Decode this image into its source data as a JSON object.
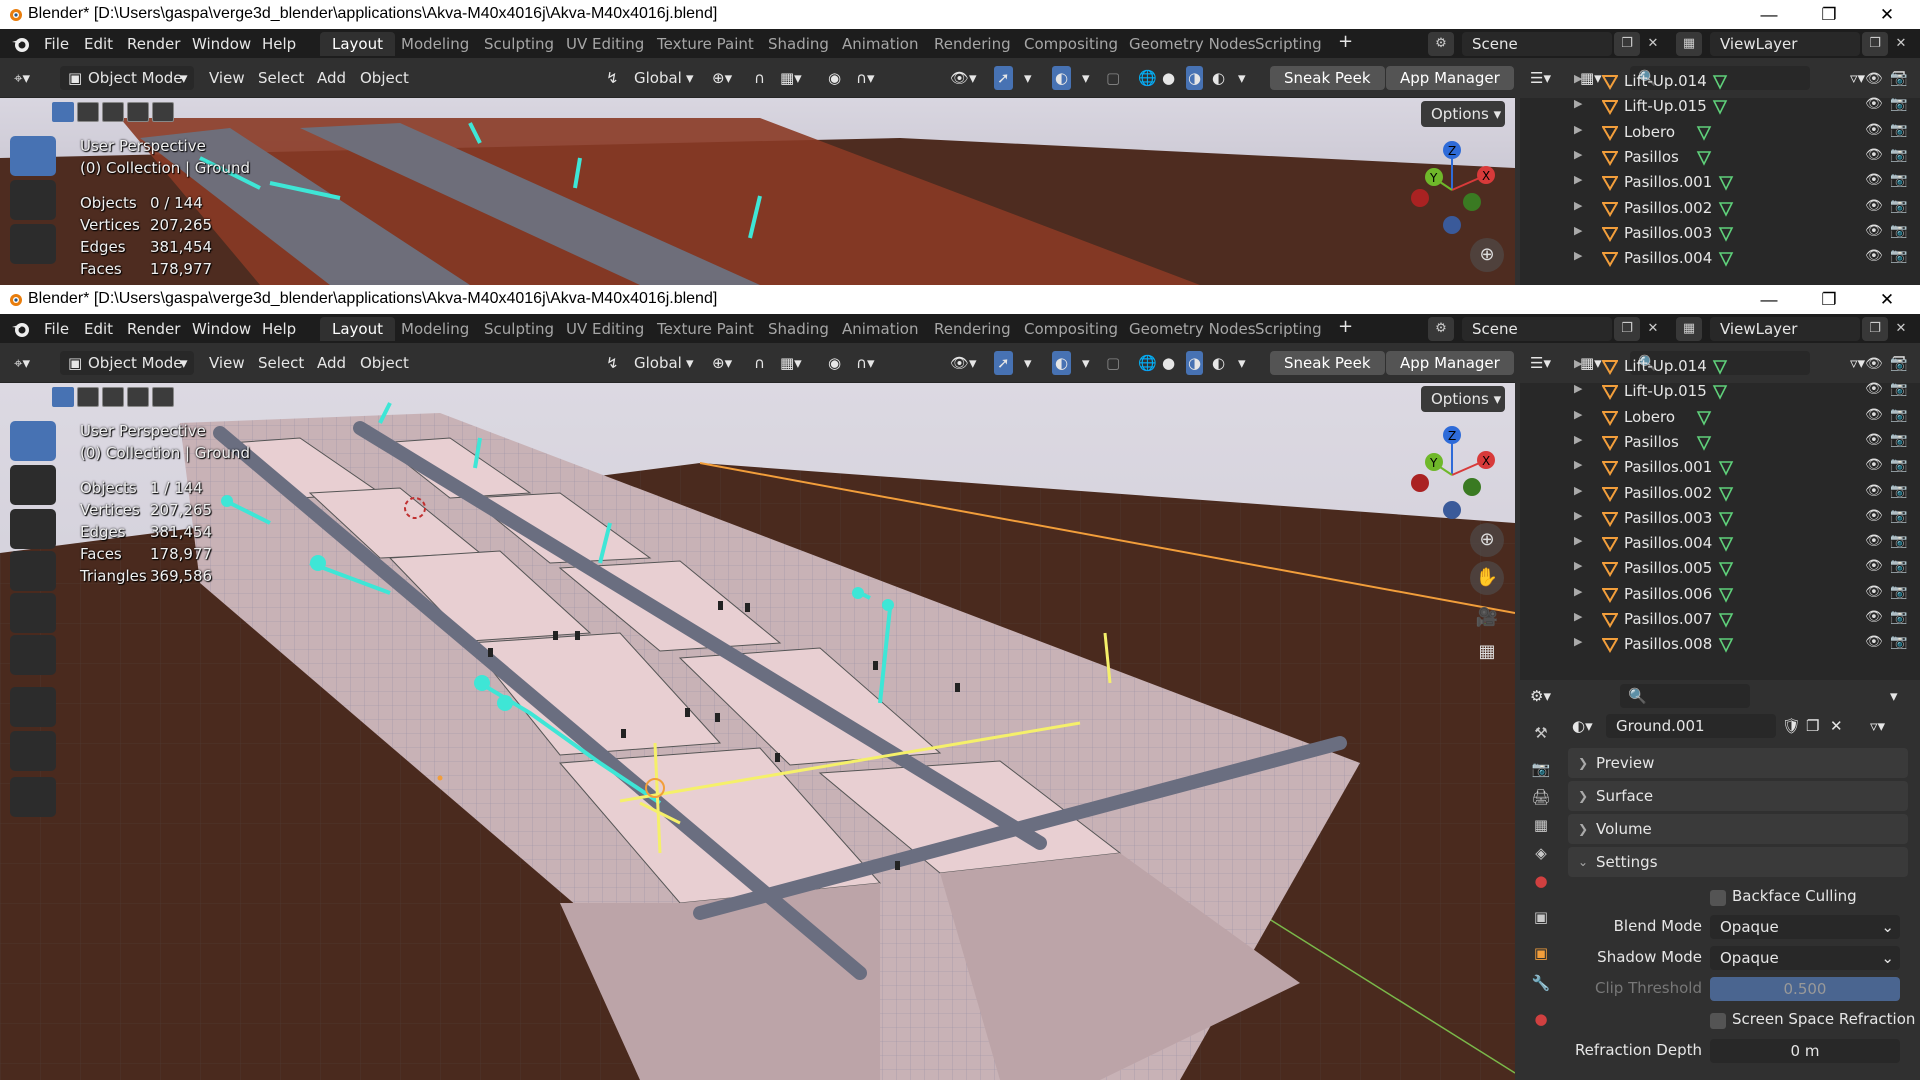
{
  "titlebar": {
    "title": "Blender* [D:\\Users\\gaspa\\verge3d_blender\\applications\\Akva-M40x4016j\\Akva-M40x4016j.blend]"
  },
  "menu": [
    "File",
    "Edit",
    "Render",
    "Window",
    "Help"
  ],
  "workspaces": [
    "Layout",
    "Modeling",
    "Sculpting",
    "UV Editing",
    "Texture Paint",
    "Shading",
    "Animation",
    "Rendering",
    "Compositing",
    "Geometry Nodes",
    "Scripting"
  ],
  "scene": {
    "name": "Scene",
    "view_layer": "ViewLayer"
  },
  "viewport_header": {
    "mode": "Object Mode",
    "menus": [
      "View",
      "Select",
      "Add",
      "Object"
    ],
    "transform_orientation": "Global",
    "sneak_peek": "Sneak Peek",
    "app_manager": "App Manager",
    "options": "Options"
  },
  "overlay": {
    "perspective": "User Perspective",
    "collection": "(0) Collection | Ground"
  },
  "stats_top": {
    "objects_label": "Objects",
    "objects": "0 / 144",
    "vertices_label": "Vertices",
    "vertices": "207,265",
    "edges_label": "Edges",
    "edges": "381,454",
    "faces_label": "Faces",
    "faces": "178,977"
  },
  "stats_bottom": {
    "objects_label": "Objects",
    "objects": "1 / 144",
    "vertices_label": "Vertices",
    "vertices": "207,265",
    "edges_label": "Edges",
    "edges": "381,454",
    "faces_label": "Faces",
    "faces": "178,977",
    "triangles_label": "Triangles",
    "triangles": "369,586"
  },
  "gizmo": {
    "x": "X",
    "y": "Y",
    "z": "Z"
  },
  "outliner_top": [
    "Lift-Up.014",
    "Lift-Up.015",
    "Lobero",
    "Pasillos",
    "Pasillos.001",
    "Pasillos.002",
    "Pasillos.003",
    "Pasillos.004"
  ],
  "outliner_bottom": [
    "Lift-Up.014",
    "Lift-Up.015",
    "Lobero",
    "Pasillos",
    "Pasillos.001",
    "Pasillos.002",
    "Pasillos.003",
    "Pasillos.004",
    "Pasillos.005",
    "Pasillos.006",
    "Pasillos.007",
    "Pasillos.008"
  ],
  "properties": {
    "material_name": "Ground.001",
    "panels": [
      "Preview",
      "Surface",
      "Volume",
      "Settings"
    ],
    "backface_culling": "Backface Culling",
    "blend_mode_label": "Blend Mode",
    "blend_mode": "Opaque",
    "shadow_mode_label": "Shadow Mode",
    "shadow_mode": "Opaque",
    "clip_threshold_label": "Clip Threshold",
    "clip_threshold": "0.500",
    "screen_space_refraction": "Screen Space Refraction",
    "refraction_depth_label": "Refraction Depth",
    "refraction_depth": "0 m"
  },
  "colors": {
    "accent": "#4772b3",
    "orange": "#f29e3b",
    "cyan": "#3ee6d6",
    "ground": "#4a2a1e"
  }
}
